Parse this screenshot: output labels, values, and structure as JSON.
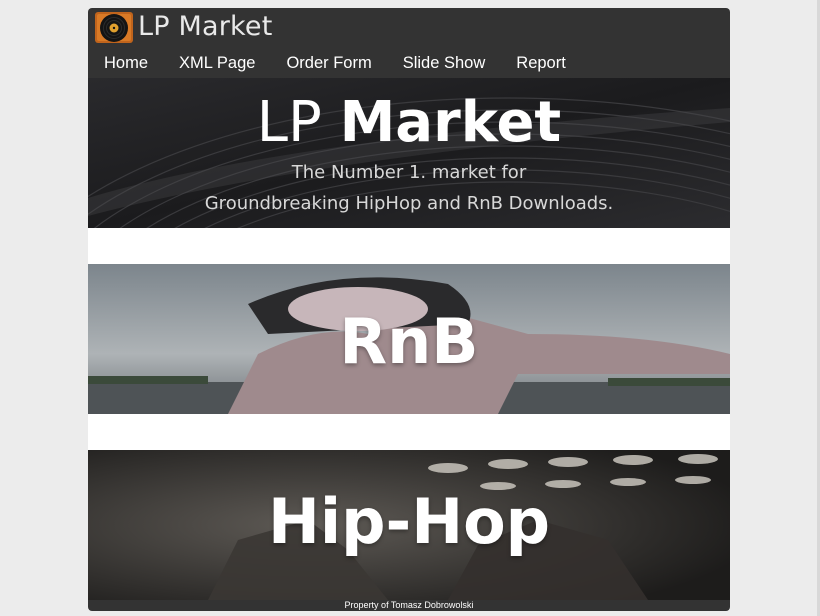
{
  "header": {
    "site_title": "LP Market",
    "logo_icon": "vinyl-record-icon"
  },
  "nav": {
    "items": [
      {
        "label": "Home"
      },
      {
        "label": "XML Page"
      },
      {
        "label": "Order Form"
      },
      {
        "label": "Slide Show"
      },
      {
        "label": "Report"
      }
    ]
  },
  "hero": {
    "title_light": "LP ",
    "title_bold": "Market",
    "subtitle_line1": "The Number 1. market for",
    "subtitle_line2": "Groundbreaking HipHop and RnB Downloads."
  },
  "genres": [
    {
      "label": "RnB"
    },
    {
      "label": "Hip-Hop"
    }
  ],
  "footer": {
    "text": "Property of Tomasz Dobrowolski"
  },
  "colors": {
    "header_bg": "#333333",
    "page_bg": "#ececec",
    "content_bg": "#ffffff",
    "nav_text": "#ffffff"
  }
}
